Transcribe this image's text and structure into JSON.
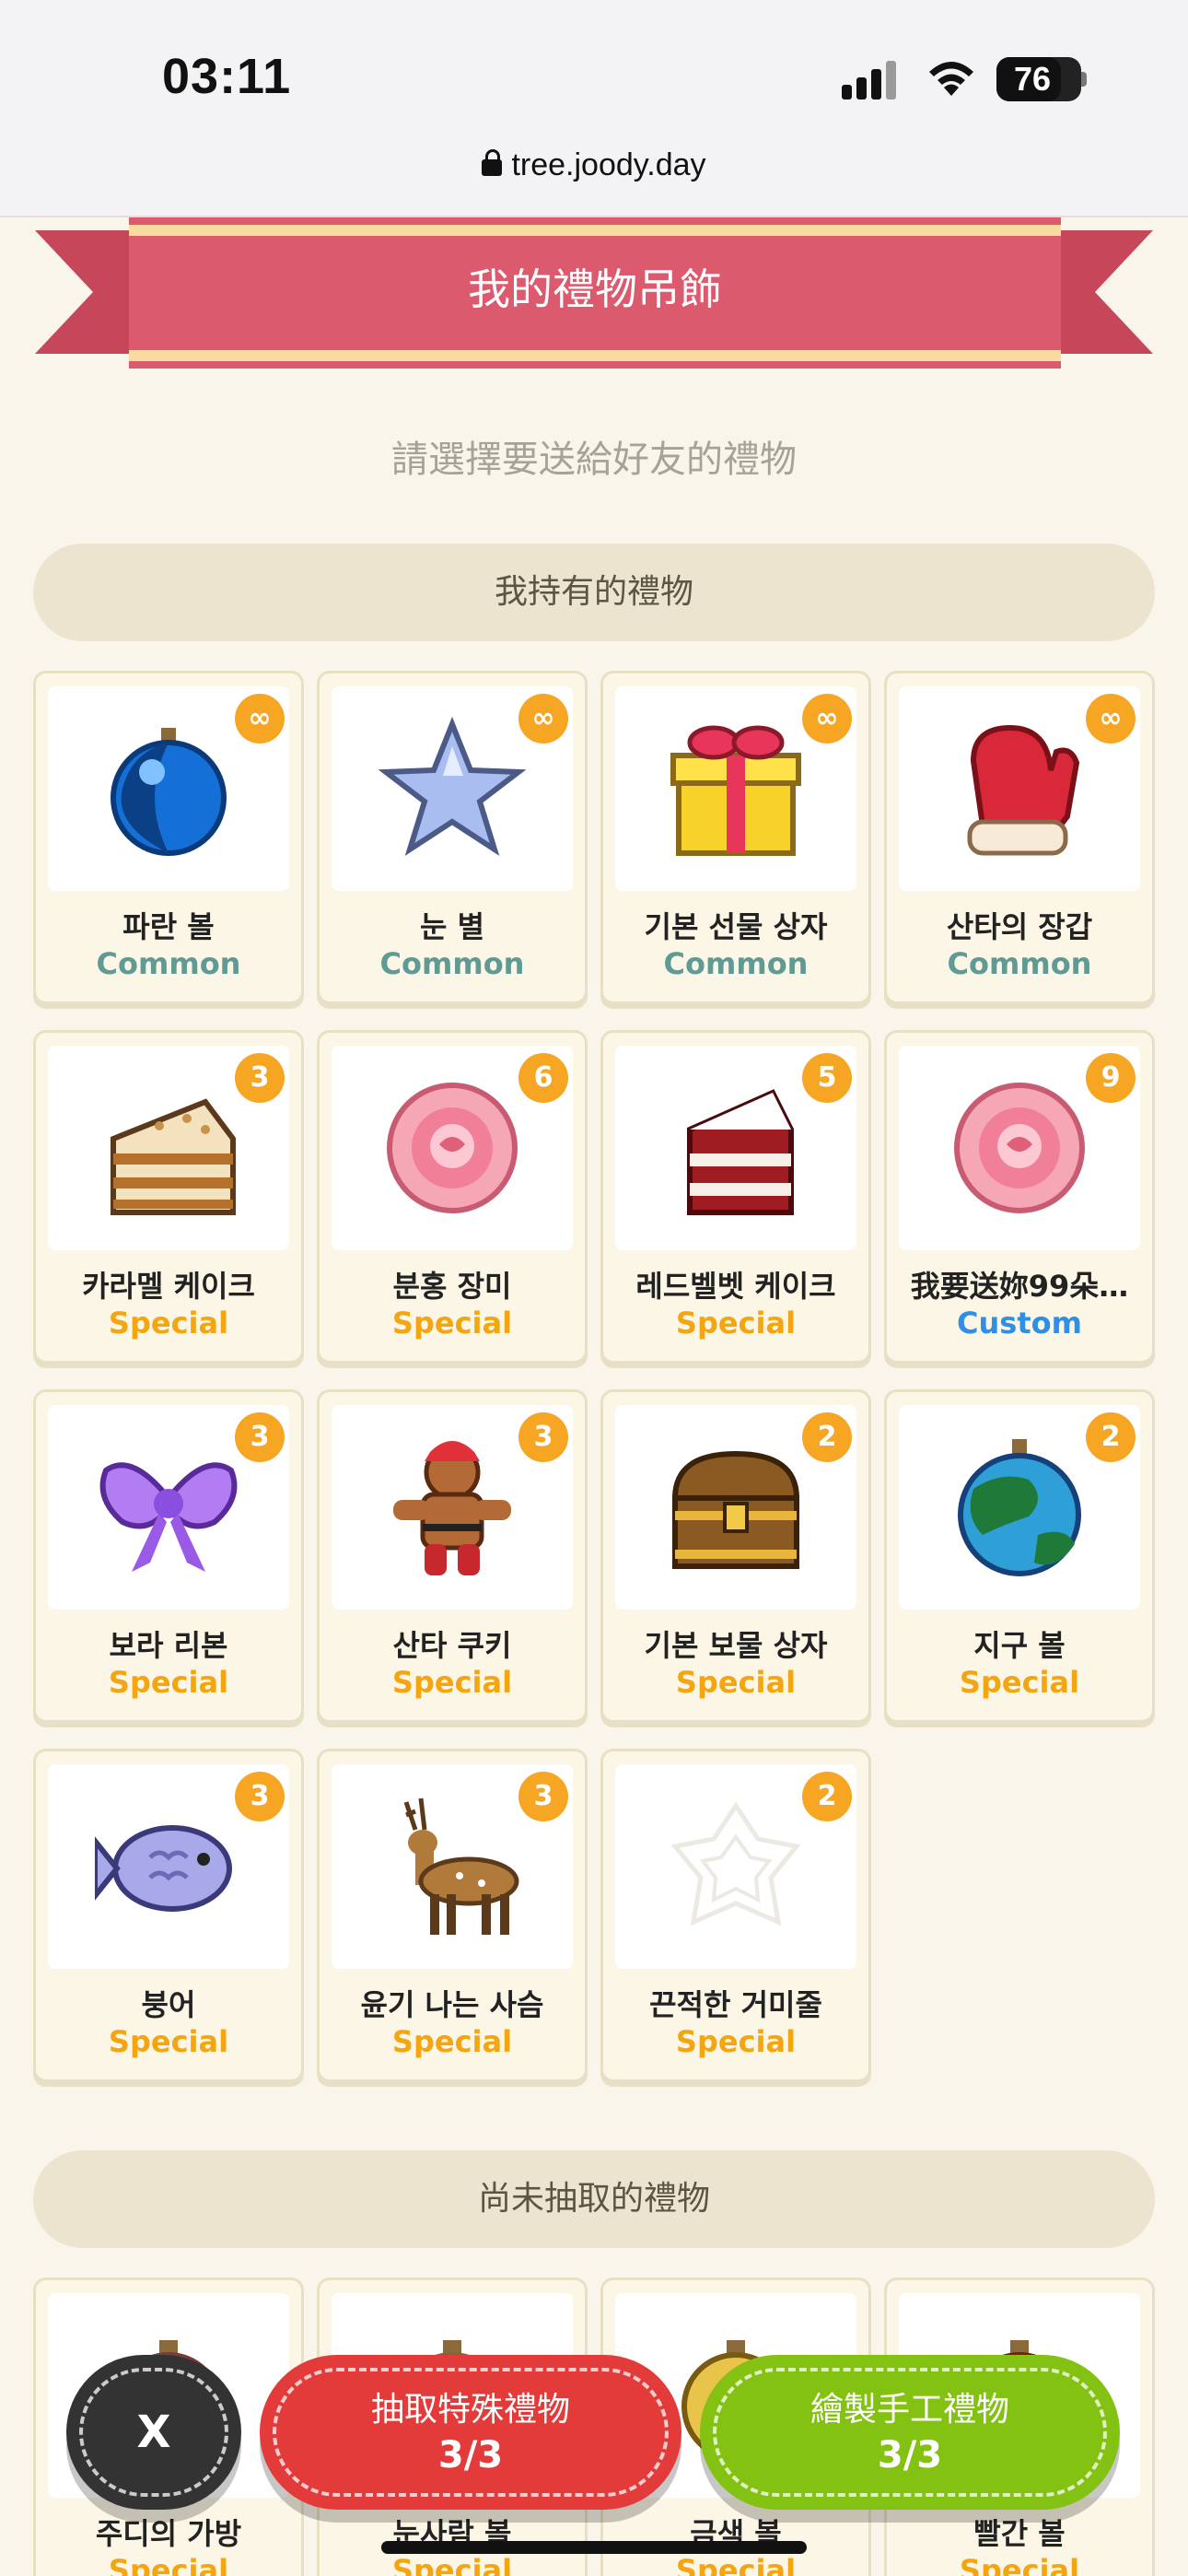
{
  "status_bar": {
    "time": "03:11",
    "battery": "76",
    "url": "tree.joody.day"
  },
  "banner": {
    "title": "我的禮物吊飾"
  },
  "subtitle": "請選擇要送給好友的禮物",
  "owned_section": {
    "title": "我持有的禮物",
    "gifts": [
      {
        "name": "파란 볼",
        "rarity": "Common",
        "count": "∞",
        "icon": "blue-ornament-icon"
      },
      {
        "name": "눈 별",
        "rarity": "Common",
        "count": "∞",
        "icon": "snow-star-icon"
      },
      {
        "name": "기본 선물 상자",
        "rarity": "Common",
        "count": "∞",
        "icon": "gift-box-icon"
      },
      {
        "name": "산타의 장갑",
        "rarity": "Common",
        "count": "∞",
        "icon": "santa-mitten-icon"
      },
      {
        "name": "카라멜 케이크",
        "rarity": "Special",
        "count": "3",
        "icon": "caramel-cake-icon"
      },
      {
        "name": "분홍 장미",
        "rarity": "Special",
        "count": "6",
        "icon": "pink-rose-icon"
      },
      {
        "name": "레드벨벳 케이크",
        "rarity": "Special",
        "count": "5",
        "icon": "red-velvet-cake-icon"
      },
      {
        "name": "我要送妳99朵…",
        "rarity": "Custom",
        "count": "9",
        "icon": "pink-rose-icon"
      },
      {
        "name": "보라 리본",
        "rarity": "Special",
        "count": "3",
        "icon": "purple-ribbon-icon"
      },
      {
        "name": "산타 쿠키",
        "rarity": "Special",
        "count": "3",
        "icon": "gingerbread-cookie-icon"
      },
      {
        "name": "기본 보물 상자",
        "rarity": "Special",
        "count": "2",
        "icon": "treasure-chest-icon"
      },
      {
        "name": "지구 볼",
        "rarity": "Special",
        "count": "2",
        "icon": "earth-ornament-icon"
      },
      {
        "name": "붕어",
        "rarity": "Special",
        "count": "3",
        "icon": "fish-bread-icon"
      },
      {
        "name": "윤기 나는 사슴",
        "rarity": "Special",
        "count": "3",
        "icon": "deer-icon"
      },
      {
        "name": "끈적한 거미줄",
        "rarity": "Special",
        "count": "2",
        "icon": "spider-web-icon"
      }
    ]
  },
  "undrawn_section": {
    "title": "尚未抽取的禮物",
    "gifts": [
      {
        "name": "주디의 가방",
        "rarity": "Special",
        "icon": "bag-ornament-icon"
      },
      {
        "name": "눈사람 볼",
        "rarity": "Special",
        "icon": "snowman-ornament-icon"
      },
      {
        "name": "금색 볼",
        "rarity": "Special",
        "icon": "gold-ornament-icon"
      },
      {
        "name": "빨간 볼",
        "rarity": "Special",
        "icon": "red-ornament-icon"
      }
    ]
  },
  "bottom_bar": {
    "close_label": "X",
    "draw_special": {
      "label": "抽取特殊禮物",
      "count": "3/3"
    },
    "craft": {
      "label": "繪製手工禮物",
      "count": "3/3"
    }
  },
  "colors": {
    "background": "#f9f5ea",
    "banner": "#dc5a6d",
    "special": "#f4a50f",
    "common": "#5f9a95",
    "custom": "#2f8ee8",
    "badge": "#f6a623",
    "draw_button": "#e33a3a",
    "craft_button": "#83c212"
  }
}
